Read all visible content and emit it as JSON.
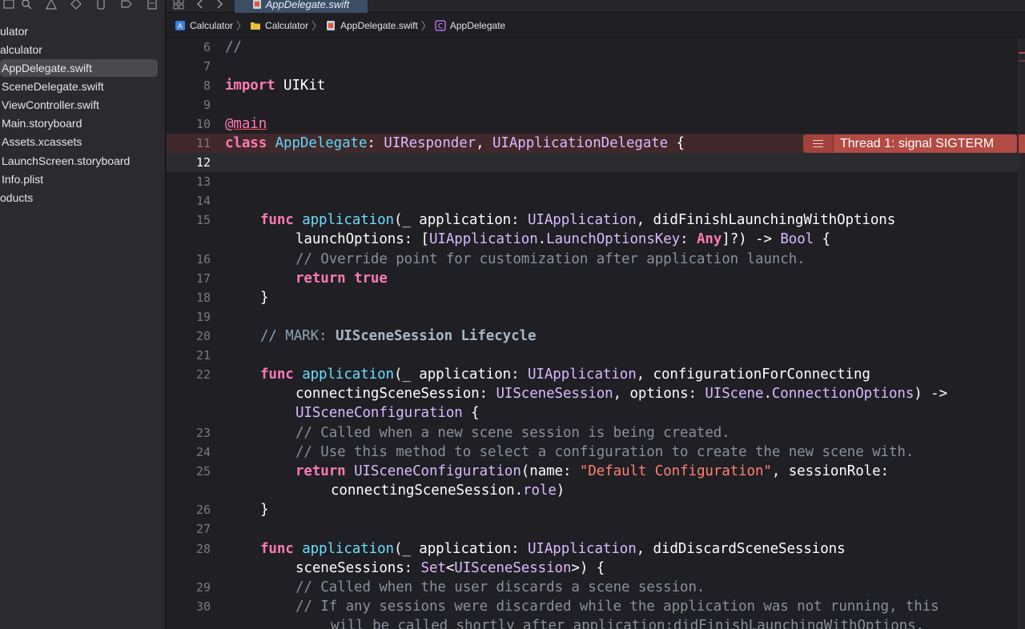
{
  "window": {
    "tab": {
      "label": "AppDelegate.swift"
    }
  },
  "navigator": {
    "items": [
      {
        "label": "ulator"
      },
      {
        "label": "alculator"
      },
      {
        "label": "AppDelegate.swift"
      },
      {
        "label": "SceneDelegate.swift"
      },
      {
        "label": "ViewController.swift"
      },
      {
        "label": "Main.storyboard"
      },
      {
        "label": "Assets.xcassets"
      },
      {
        "label": "LaunchScreen.storyboard"
      },
      {
        "label": "Info.plist"
      },
      {
        "label": "oducts"
      }
    ]
  },
  "breadcrumb": {
    "items": [
      {
        "label": "Calculator",
        "icon": "project-icon"
      },
      {
        "label": "Calculator",
        "icon": "folder-icon"
      },
      {
        "label": "AppDelegate.swift",
        "icon": "swift-file-icon"
      },
      {
        "label": "AppDelegate",
        "icon": "class-icon"
      }
    ]
  },
  "editor": {
    "line_numbers": [
      "6",
      "7",
      "8",
      "9",
      "10",
      "11",
      "12",
      "13",
      "14",
      "15",
      "16",
      "17",
      "18",
      "19",
      "20",
      "21",
      "22",
      "23",
      "24",
      "25",
      "26",
      "27",
      "28",
      "29",
      "30"
    ],
    "current_line": "12",
    "code": {
      "l6": "//",
      "l8_kw": "import",
      "l8_mod": " UIKit",
      "l10_attr": "@main",
      "l11_kw": "class",
      "l11_name": "AppDelegate",
      "l11_p1": ": ",
      "l11_t1": "UIResponder",
      "l11_p2": ", ",
      "l11_t2": "UIApplicationDelegate",
      "l11_p3": " {",
      "func": "func",
      "application": "application",
      "l15_a": "(_ application: ",
      "UIApplication": "UIApplication",
      "l15_b": ", didFinishLaunchingWithOptions",
      "l15c_a": "launchOptions: [",
      "l15c_t1": "UIApplication",
      "l15c_dot": ".",
      "l15c_t2": "LaunchOptionsKey",
      "l15c_b": ": ",
      "l15c_any": "Any",
      "l15c_c": "]?) -> ",
      "l15c_bool": "Bool",
      "l15c_d": " {",
      "l16": "// Override point for customization after application launch.",
      "return": "return",
      "true_kw": "true",
      "close_brace": "}",
      "l20_cm": "// MARK: ",
      "l20_mark": "UISceneSession Lifecycle",
      "l22_b": ", configurationForConnecting",
      "l22c_a": "connectingSceneSession: ",
      "l22c_t1": "UISceneSession",
      "l22c_b": ", options: ",
      "l22c_t2": "UIScene",
      "l22c_t3": "ConnectionOptions",
      "l22c_c": ") ->",
      "l22d_t": "UISceneConfiguration",
      "l22d_b": " {",
      "l23": "// Called when a new scene session is being created.",
      "l24": "// Use this method to select a configuration to create the new scene with.",
      "l25_t": "UISceneConfiguration",
      "l25_a": "(name: ",
      "l25_str": "\"Default Configuration\"",
      "l25_b": ", sessionRole:",
      "l25c_a": "connectingSceneSession.",
      "l25c_role": "role",
      "l25c_b": ")",
      "l28_b": ", didDiscardSceneSessions",
      "l28c_a": "sceneSessions: ",
      "l28c_set": "Set",
      "l28c_lt": "<",
      "l28c_t": "UISceneSession",
      "l28c_b": ">) {",
      "l29": "// Called when the user discards a scene session.",
      "l30": "// If any sessions were discarded while the application was not running, this",
      "l30c": "will be called shortly after application:didFinishLaunchingWithOptions."
    },
    "error": {
      "line": "11",
      "message": "Thread 1: signal SIGTERM",
      "color": "#b24b44"
    }
  }
}
